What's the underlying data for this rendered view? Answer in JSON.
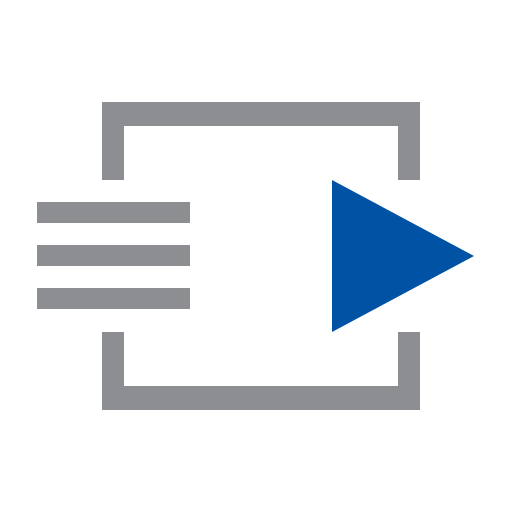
{
  "icon": {
    "name": "play-list-icon",
    "description_name": "queue-play-icon"
  },
  "colors": {
    "frame_gray": "#8c8e91",
    "lines_gray": "#8c8e91",
    "play_blue": "#0052a5",
    "background": "#ffffff"
  }
}
